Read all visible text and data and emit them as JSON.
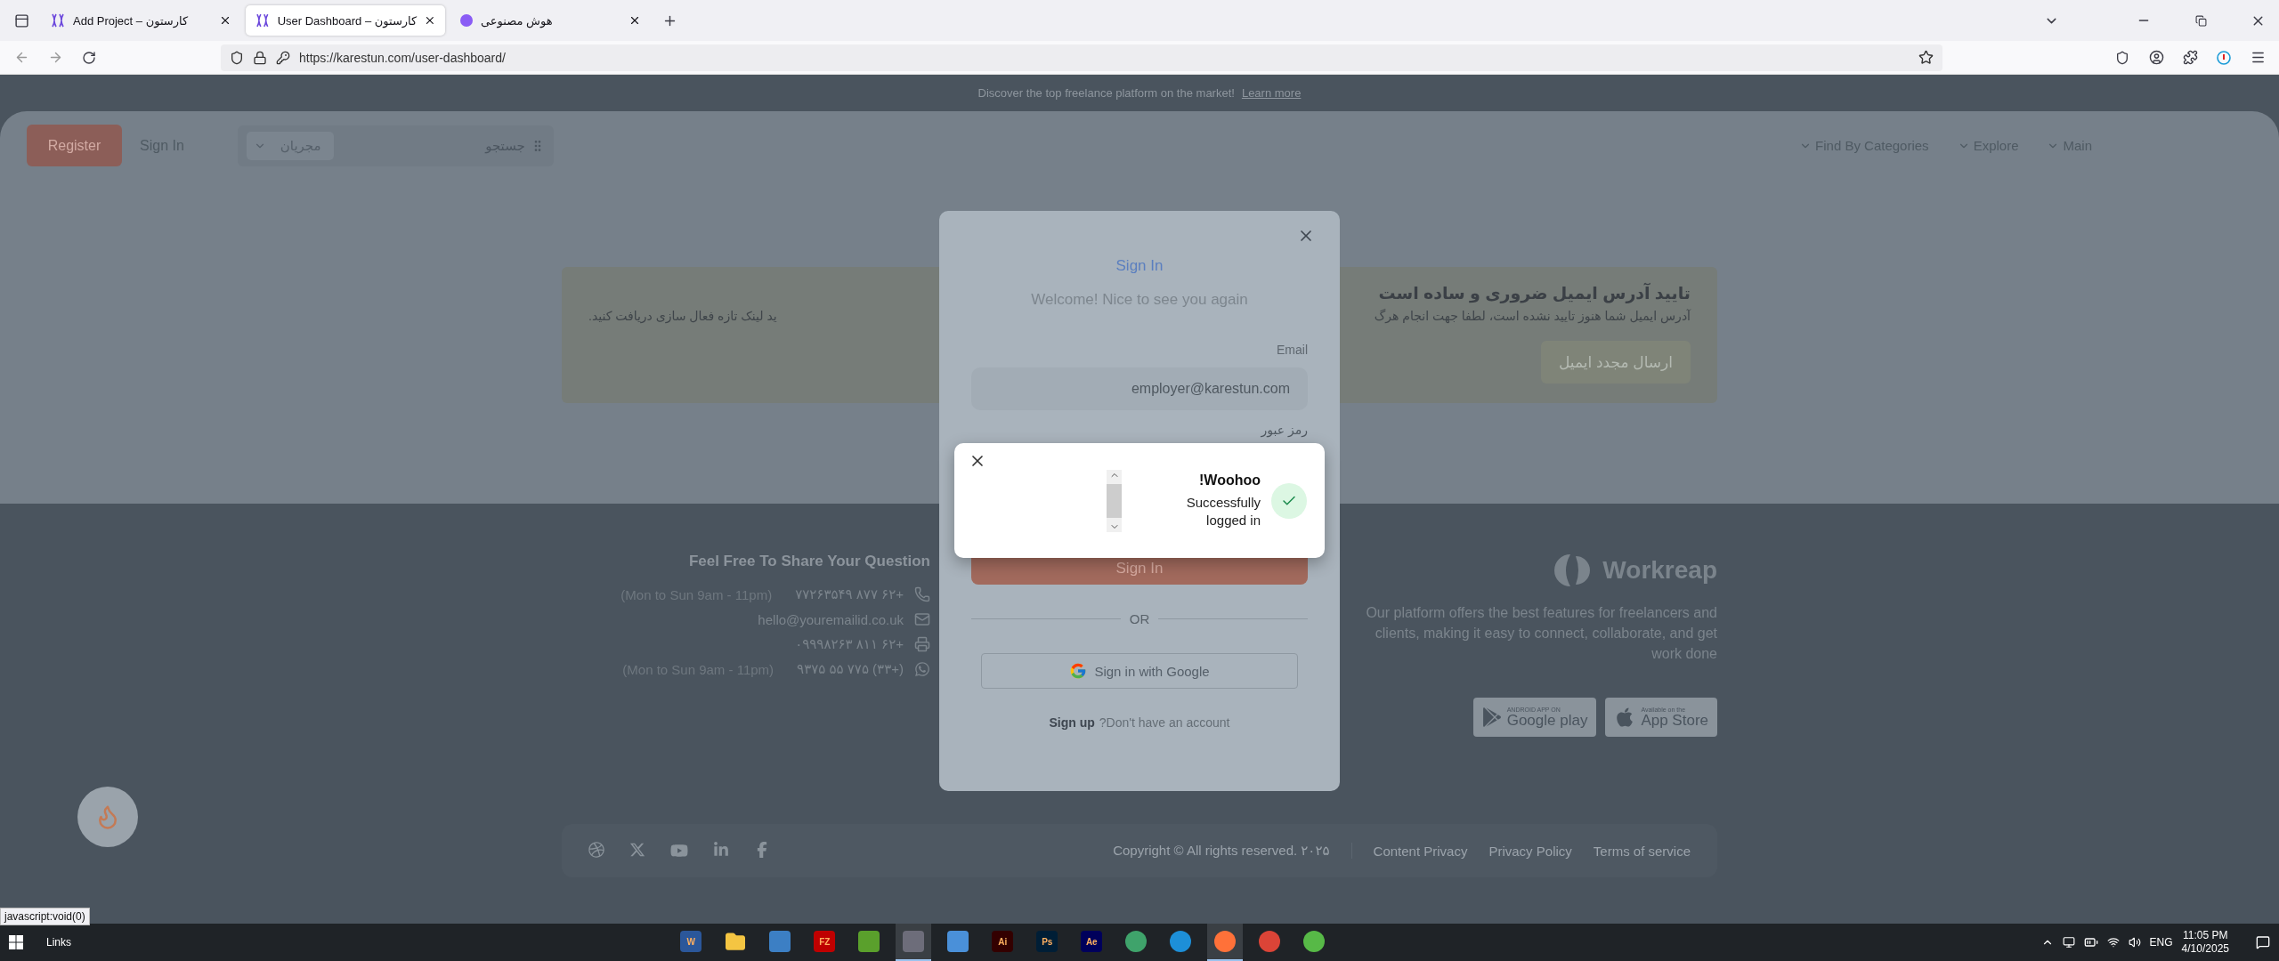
{
  "browser": {
    "tabs": [
      {
        "title": "Add Project – کارستون",
        "kind": "logo",
        "selected": false
      },
      {
        "title": "User Dashboard – کارستون",
        "kind": "logo",
        "selected": true
      },
      {
        "title": "هوش مصنوعی",
        "kind": "dot",
        "selected": false
      }
    ],
    "url": "https://karestun.com/user-dashboard/"
  },
  "announcement": {
    "text": "Discover the top freelance platform on the market!",
    "link": "Learn more"
  },
  "header": {
    "register": "Register",
    "sign_in": "Sign In",
    "search_placeholder": "جستجو",
    "search_filter": "مجریان",
    "nav": [
      "Find By Categories",
      "Explore",
      "Main"
    ]
  },
  "alert": {
    "title": "تایید آدرس ایمیل ضروری و ساده است",
    "text_start": "آدرس ایمیل شما هنوز تایید نشده است، لطفا جهت انجام هرگ",
    "text_end": "ید لینک تازه فعال سازی دریافت کنید.",
    "button": "ارسال مجدد ایمیل"
  },
  "footer": {
    "brand": "Workreap",
    "description": "Our platform offers the best features for freelancers and clients, making it easy to connect, collaborate, and get work done",
    "stores": [
      {
        "kind": "google",
        "small": "ANDROID APP ON",
        "big": "Google play"
      },
      {
        "kind": "apple",
        "small": "Available on the",
        "big": "App Store"
      }
    ],
    "contact_title": "Feel Free To Share Your Question",
    "contacts": [
      {
        "kind": "phone",
        "value": "۷۷۲۶۳۵۴۹ ۸۷۷ ۶۲+",
        "note": "(Mon to Sun 9am - 11pm)"
      },
      {
        "kind": "mail",
        "value": "hello@youremailid.co.uk"
      },
      {
        "kind": "fax",
        "value": "۰۹۹۹۸۲۶۳ ۸۱۱ ۶۲+"
      },
      {
        "kind": "whatsapp",
        "value": "۹۳۷۵ ۵۵ ۷۷۵ (۳۳+)",
        "note": "(Mon to Sun 9am - 11pm)"
      }
    ],
    "socials": [
      {
        "kind": "dribbble"
      },
      {
        "kind": "x"
      },
      {
        "kind": "youtube"
      },
      {
        "kind": "linkedin"
      },
      {
        "kind": "facebook"
      }
    ],
    "copyright": "Copyright © All rights reserved. ۲۰۲۵",
    "links": [
      "Content Privacy",
      "Privacy Policy",
      "Terms of service"
    ]
  },
  "modal": {
    "title": "Sign In",
    "subtitle": "Welcome! Nice to see you again",
    "email_label": "Email",
    "email_value": "employer@karestun.com",
    "password_label": "رمز عبور",
    "submit": "Sign In",
    "divider": "OR",
    "google": "Sign in with Google",
    "signup_link": "Sign up",
    "signup_prompt": "?Don't have an account"
  },
  "toast": {
    "title": "!Woohoo",
    "message": "Successfully logged in"
  },
  "status_text": "javascript:void(0)",
  "taskbar": {
    "toolbar_label": "Links",
    "apps": [
      {
        "kind": "tile",
        "color": "#2b579a",
        "label": "W",
        "active": false
      },
      {
        "kind": "folder",
        "color": "#f4c542",
        "active": false
      },
      {
        "kind": "tile",
        "color": "#3c7fc4",
        "active": false
      },
      {
        "kind": "tile",
        "color": "#bf0000",
        "label": "FZ",
        "active": false
      },
      {
        "kind": "tile",
        "color": "#5aa02c",
        "active": false
      },
      {
        "kind": "tile",
        "color": "#6d6d7a",
        "active": true
      },
      {
        "kind": "tile",
        "color": "#4a90d9",
        "active": false
      },
      {
        "kind": "tile",
        "color": "#330000",
        "label": "Ai",
        "active": false
      },
      {
        "kind": "tile",
        "color": "#001e36",
        "label": "Ps",
        "active": false
      },
      {
        "kind": "tile",
        "color": "#00005b",
        "label": "Ae",
        "active": false
      },
      {
        "kind": "round",
        "color": "#3fa36b",
        "active": false
      },
      {
        "kind": "round",
        "color": "#1d8fd8",
        "active": false
      },
      {
        "kind": "round",
        "color": "#ff7139",
        "active": true
      },
      {
        "kind": "round",
        "color": "#db4437",
        "active": false
      },
      {
        "kind": "round",
        "color": "#57b947",
        "active": false
      }
    ],
    "language": "ENG",
    "time": "11:05 PM",
    "date": "4/10/2025"
  }
}
